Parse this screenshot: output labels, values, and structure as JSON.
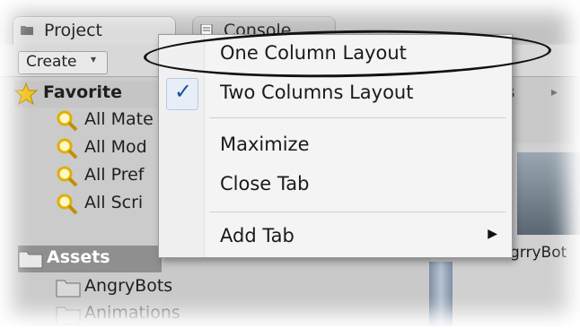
{
  "tabs": {
    "project": "Project",
    "console": "Console"
  },
  "toolbar": {
    "create_label": "Create",
    "create_arrow": "▾"
  },
  "tree": {
    "favorites_label": "Favorite",
    "favorites": [
      "All Mate",
      "All Mod",
      "All Pref",
      "All Scri"
    ],
    "assets_label": "Assets",
    "assets_children": [
      "AngryBots",
      "Animations"
    ]
  },
  "right_panel": {
    "breadcrumb": "ets",
    "breadcrumb_arrow": "▸",
    "thumb_label": "grryBot"
  },
  "context_menu": {
    "items": [
      {
        "label": "One Column Layout",
        "checked": false
      },
      {
        "label": "Two Columns Layout",
        "checked": true
      },
      {
        "label": "Maximize",
        "checked": false
      },
      {
        "label": "Close Tab",
        "checked": false
      },
      {
        "label": "Add Tab",
        "checked": false,
        "submenu": true
      }
    ],
    "check_glyph": "✓",
    "submenu_arrow": "▶"
  },
  "colors": {
    "check_blue": "#1a4fa0",
    "assets_header_bg": "#8f8f8f",
    "ellipse_stroke": "#111111"
  },
  "icons": {
    "project_tab": "folder-icon",
    "console_tab": "console-icon",
    "favorites": "star-icon",
    "search_filter": "magnifier-icon",
    "assets": "folder-icon"
  }
}
